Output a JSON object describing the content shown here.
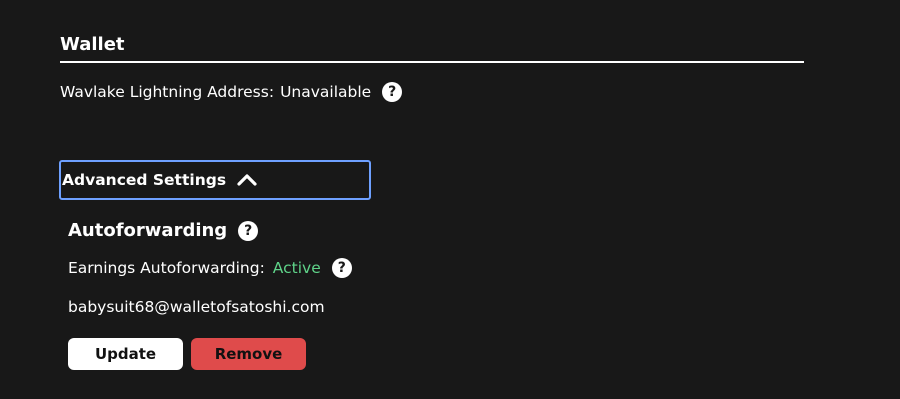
{
  "wallet": {
    "title": "Wallet",
    "lightning_label": "Wavlake Lightning Address:",
    "lightning_value": "Unavailable",
    "help_glyph": "?"
  },
  "advanced": {
    "label": "Advanced Settings",
    "expanded": true,
    "icon": "chevron-up-icon",
    "focus_color": "#6ea0ff"
  },
  "autoforwarding": {
    "title": "Autoforwarding",
    "earnings_label": "Earnings Autoforwarding:",
    "status": "Active",
    "status_color": "#5fd389",
    "address": "babysuit68@walletofsatoshi.com",
    "update_label": "Update",
    "remove_label": "Remove",
    "remove_color": "#df4b4b"
  }
}
